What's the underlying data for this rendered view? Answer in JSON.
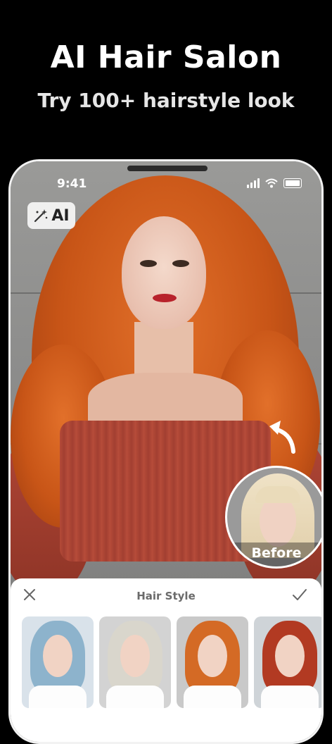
{
  "promo": {
    "headline": "AI Hair Salon",
    "subline": "Try 100+ hairstyle look"
  },
  "status_bar": {
    "time": "9:41",
    "icons": [
      "signal-icon",
      "wifi-icon",
      "battery-icon"
    ]
  },
  "ai_badge": {
    "label": "AI",
    "icon": "magic-wand-icon"
  },
  "before_preview": {
    "label": "Before"
  },
  "panel": {
    "title": "Hair Style",
    "close_icon": "close-icon",
    "confirm_icon": "check-icon",
    "styles": [
      {
        "hair_color": "#8db3cc"
      },
      {
        "hair_color": "#d9d6cc"
      },
      {
        "hair_color": "#d46a25"
      },
      {
        "hair_color": "#b23a22"
      }
    ]
  },
  "colors": {
    "background": "#000000",
    "hair_orange": "#d2621f",
    "panel_bg": "#ffffff",
    "title_gray": "#6b6b6b"
  }
}
